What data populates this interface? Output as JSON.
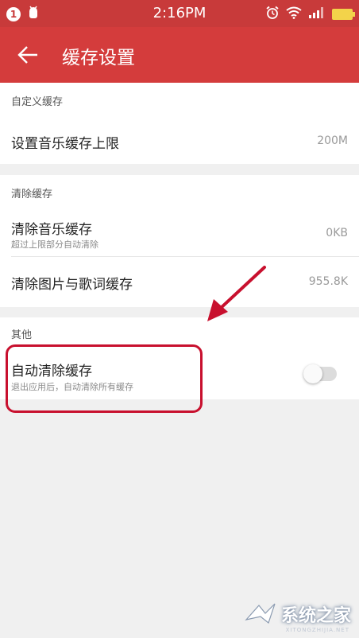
{
  "status_bar": {
    "notification_count": "1",
    "time": "2:16PM"
  },
  "toolbar": {
    "title": "缓存设置"
  },
  "sections": {
    "custom": {
      "header": "自定义缓存",
      "rows": [
        {
          "title": "设置音乐缓存上限",
          "value": "200M"
        }
      ]
    },
    "clear": {
      "header": "清除缓存",
      "rows": [
        {
          "title": "清除音乐缓存",
          "subtitle": "超过上限部分自动清除",
          "value": "0KB"
        },
        {
          "title": "清除图片与歌词缓存",
          "value": "955.8K"
        }
      ]
    },
    "other": {
      "header": "其他",
      "rows": [
        {
          "title": "自动清除缓存",
          "subtitle": "退出应用后，自动清除所有缓存",
          "toggle_on": false
        }
      ]
    }
  },
  "watermark": {
    "text": "系统之家",
    "sub": "XITONGZHIJIA.NET"
  },
  "colors": {
    "toolbar": "#d43c3c",
    "annotation": "#c8102e"
  }
}
